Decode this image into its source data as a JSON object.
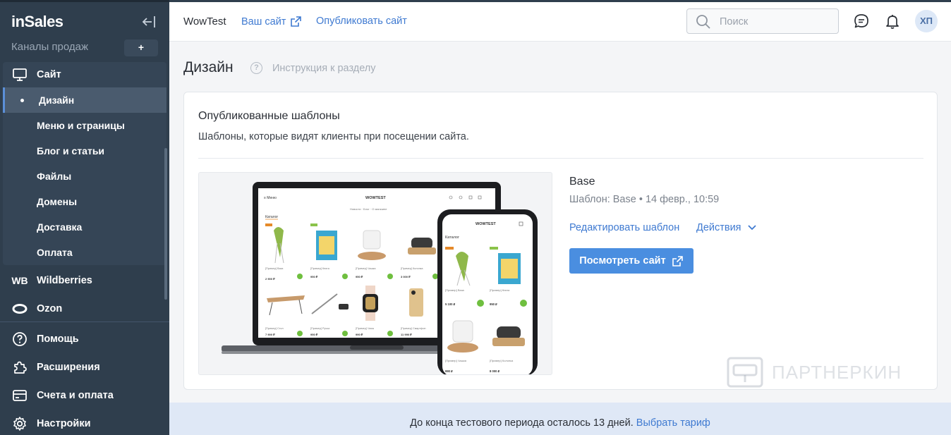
{
  "sidebar": {
    "logo": "inSales",
    "channels_label": "Каналы продаж",
    "add_label": "+",
    "site_label": "Сайт",
    "sub_items": [
      {
        "label": "Дизайн"
      },
      {
        "label": "Меню и страницы"
      },
      {
        "label": "Блог и статьи"
      },
      {
        "label": "Файлы"
      },
      {
        "label": "Домены"
      },
      {
        "label": "Доставка"
      },
      {
        "label": "Оплата"
      }
    ],
    "channels": [
      {
        "label": "Wildberries",
        "icon": "WB"
      },
      {
        "label": "Ozon"
      }
    ],
    "bottom_items": [
      {
        "label": "Помощь"
      },
      {
        "label": "Расширения"
      },
      {
        "label": "Счета и оплата"
      },
      {
        "label": "Настройки"
      }
    ]
  },
  "header": {
    "shop_name": "WowTest",
    "your_site": "Ваш сайт",
    "publish_site": "Опубликовать сайт",
    "search_placeholder": "Поиск",
    "avatar": "ХП"
  },
  "main": {
    "title": "Дизайн",
    "help_glyph": "?",
    "help_link": "Инструкция к разделу",
    "card": {
      "title": "Опубликованные шаблоны",
      "description": "Шаблоны, которые видят клиенты при посещении сайта.",
      "template_name": "Base",
      "template_meta": "Шаблон: Base • 14 февр., 10:59",
      "edit_link": "Редактировать шаблон",
      "actions_link": "Действия",
      "view_button": "Посмотреть сайт"
    },
    "preview": {
      "laptop_brand": "WOWTEST",
      "laptop_menu": "≡ Меню",
      "laptop_nav": "Новости · Блог · О магазине",
      "catalog": "Каталог",
      "phone_brand": "WOWTEST",
      "product_prices": [
        "2 900 ₽",
        "950 ₽",
        "950 ₽",
        "3 000 ₽",
        "5 100 ₽",
        "950 ₽",
        "7 900 ₽",
        "950 ₽",
        "990 ₽",
        "11 990 ₽",
        "990 ₽",
        "8 000 ₽"
      ]
    }
  },
  "watermark": "ПАРТНЕРКИН",
  "banner": {
    "text": "До конца тестового периода осталось 13 дней.",
    "link": "Выбрать тариф"
  }
}
